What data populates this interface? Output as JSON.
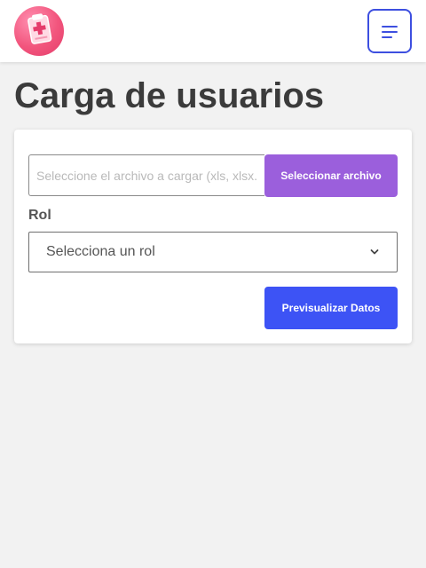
{
  "header": {
    "logo_icon": "clipboard-medical-icon",
    "menu_icon": "hamburger-menu-icon",
    "accent_color": "#3d4fe0"
  },
  "main": {
    "title": "Carga de usuarios",
    "file_input": {
      "placeholder": "Seleccione el archivo a cargar (xls, xlsx...",
      "value": ""
    },
    "select_file_button": {
      "label": "Seleccionar archivo",
      "color": "#9b5fdc"
    },
    "rol_label": "Rol",
    "role_select": {
      "selected": "Selecciona un rol",
      "icon": "chevron-down-icon"
    },
    "preview_button": {
      "label": "Previsualizar Datos",
      "color": "#3d53f5"
    }
  }
}
